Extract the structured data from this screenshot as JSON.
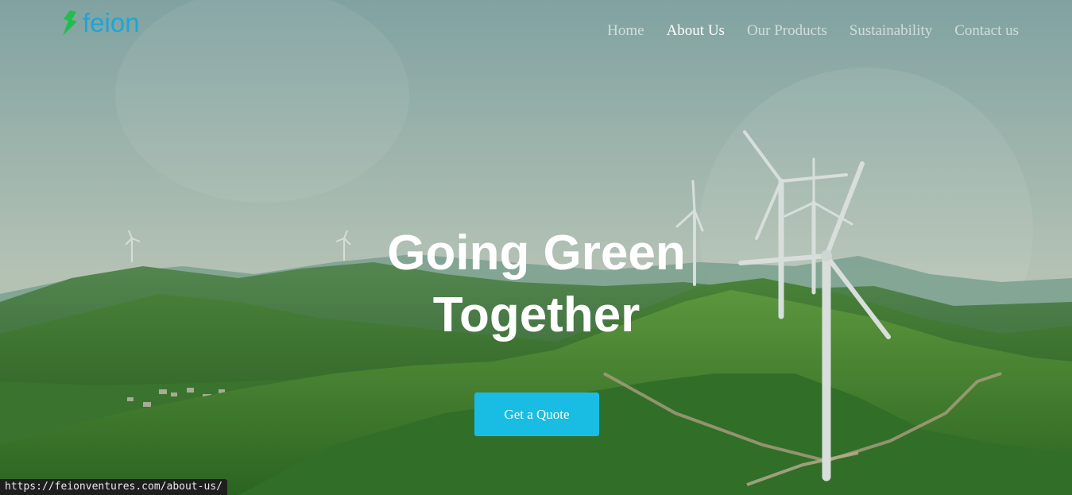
{
  "brand": {
    "name": "feion",
    "logo_color": "#1ba6d9",
    "mark_color": "#1fbf4a"
  },
  "nav": {
    "items": [
      {
        "label": "Home",
        "active": false
      },
      {
        "label": "About Us",
        "active": true
      },
      {
        "label": "Our Products",
        "active": false
      },
      {
        "label": "Sustainability",
        "active": false
      },
      {
        "label": "Contact us",
        "active": false
      }
    ]
  },
  "hero": {
    "title_line1": "Going Green",
    "title_line2": "Together",
    "cta_label": "Get a Quote",
    "cta_color": "#19bde3"
  },
  "status_bar": {
    "url": "https://feionventures.com/about-us/"
  }
}
